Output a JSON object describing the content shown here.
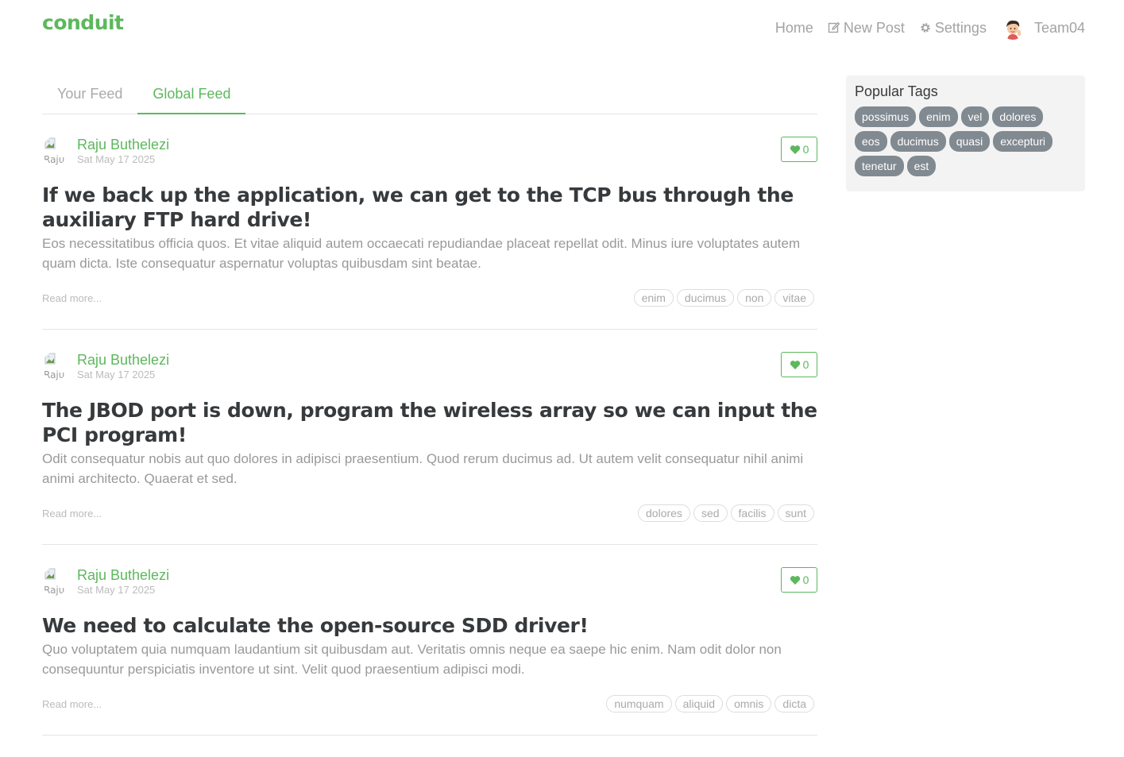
{
  "brand": "conduit",
  "nav": {
    "home": "Home",
    "new_post": "New Post",
    "settings": "Settings",
    "user": "Team04"
  },
  "tabs": {
    "your_feed": "Your Feed",
    "global_feed": "Global Feed"
  },
  "articles": [
    {
      "author": "Raju Buthelezi",
      "avatar_alt": "Raju",
      "date": "Sat May 17 2025",
      "favorites": "0",
      "title": "If we back up the application, we can get to the TCP bus through the auxiliary FTP hard drive!",
      "description": "Eos necessitatibus officia quos. Et vitae aliquid autem occaecati repudiandae placeat repellat odit. Minus iure voluptates autem quam dicta. Iste consequatur aspernatur voluptas quibusdam sint beatae.",
      "read_more": "Read more...",
      "tags": [
        "enim",
        "ducimus",
        "non",
        "vitae"
      ]
    },
    {
      "author": "Raju Buthelezi",
      "avatar_alt": "Raju",
      "date": "Sat May 17 2025",
      "favorites": "0",
      "title": "The JBOD port is down, program the wireless array so we can input the PCI program!",
      "description": "Odit consequatur nobis aut quo dolores in adipisci praesentium. Quod rerum ducimus ad. Ut autem velit consequatur nihil animi animi architecto. Quaerat et sed.",
      "read_more": "Read more...",
      "tags": [
        "dolores",
        "sed",
        "facilis",
        "sunt"
      ]
    },
    {
      "author": "Raju Buthelezi",
      "avatar_alt": "Raju",
      "date": "Sat May 17 2025",
      "favorites": "0",
      "title": "We need to calculate the open-source SDD driver!",
      "description": "Quo voluptatem quia numquam laudantium sit quibusdam aut. Veritatis omnis neque ea saepe hic enim. Nam odit dolor non consequuntur perspiciatis inventore ut sint. Velit quod praesentium adipisci modi.",
      "read_more": "Read more...",
      "tags": [
        "numquam",
        "aliquid",
        "omnis",
        "dicta"
      ]
    }
  ],
  "sidebar": {
    "title": "Popular Tags",
    "tags": [
      "possimus",
      "enim",
      "vel",
      "dolores",
      "eos",
      "ducimus",
      "quasi",
      "excepturi",
      "tenetur",
      "est"
    ]
  },
  "colors": {
    "accent": "#5cb85c",
    "tag_pill": "#818a91",
    "muted_text": "#999999"
  }
}
